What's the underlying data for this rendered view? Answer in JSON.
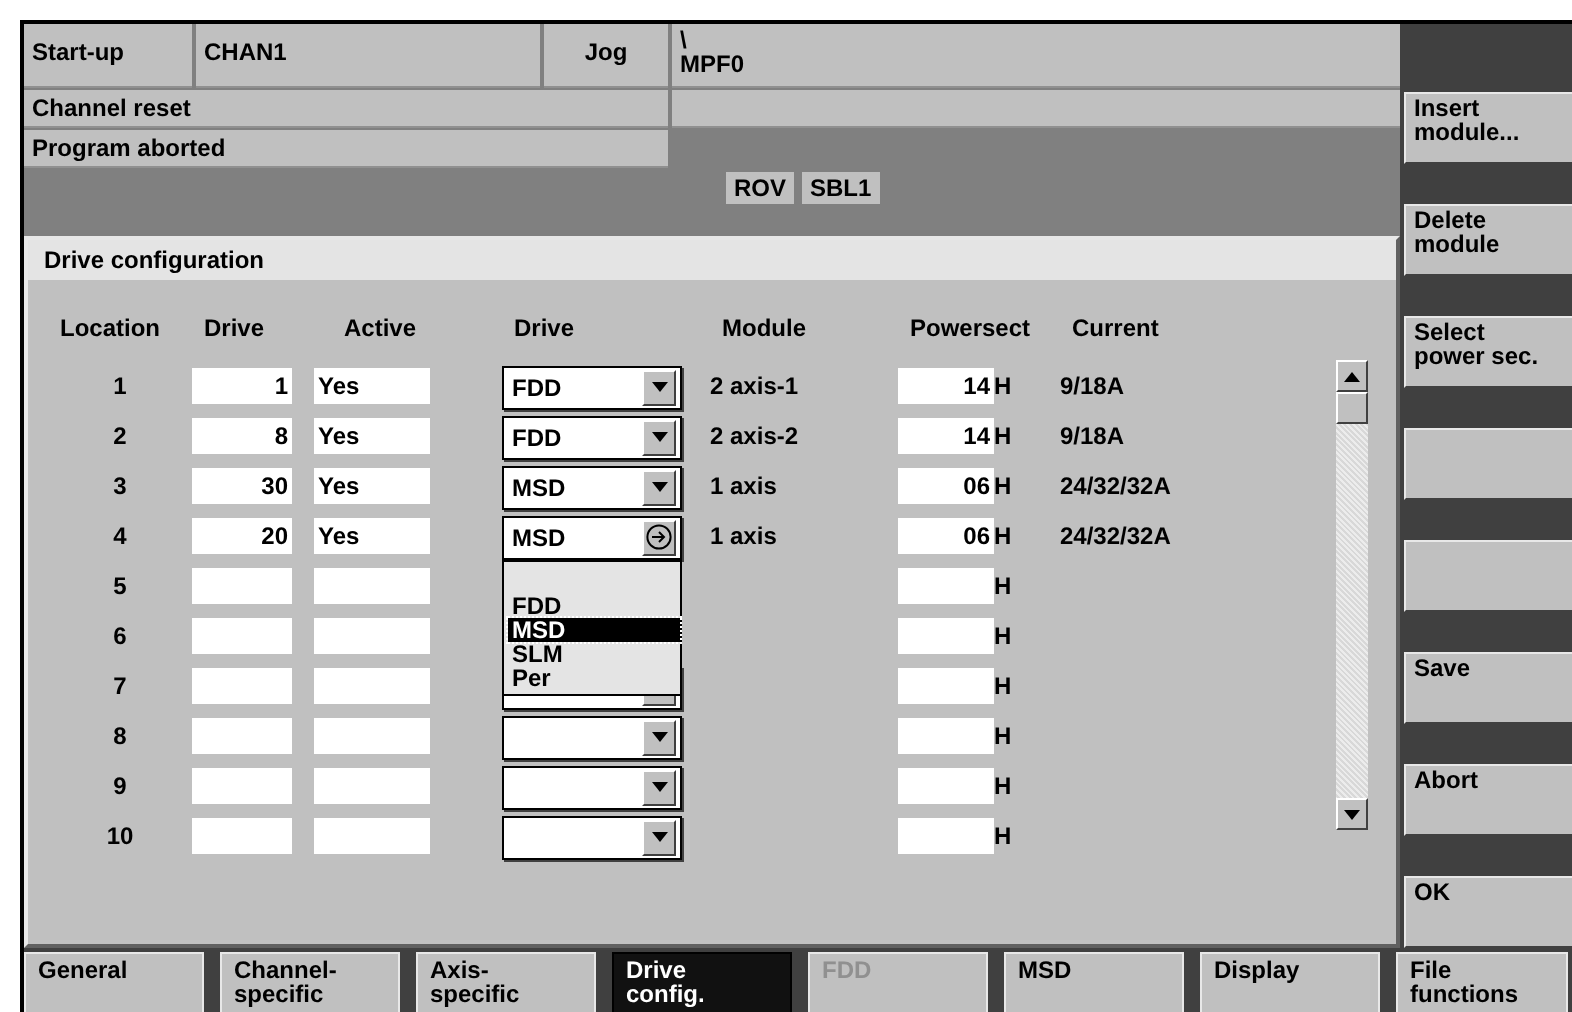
{
  "header": {
    "mode": "Start-up",
    "channel": "CHAN1",
    "op_mode": "Jog",
    "path": "\\",
    "program": "MPF0",
    "status_1": "Channel reset",
    "status_2": "Program aborted",
    "indicators": [
      "ROV",
      "SBL1"
    ]
  },
  "panel": {
    "title": "Drive configuration",
    "columns": [
      "Location",
      "Drive",
      "Active",
      "Drive",
      "Module",
      "Powersect",
      "Current"
    ],
    "rows": [
      {
        "location": "1",
        "drive": "1",
        "active": "Yes",
        "combo": true,
        "open": false,
        "drive_type": "FDD",
        "module": "2 axis-1",
        "powersect": "14",
        "unit": "H",
        "current": "9/18A"
      },
      {
        "location": "2",
        "drive": "8",
        "active": "Yes",
        "combo": true,
        "open": false,
        "drive_type": "FDD",
        "module": "2 axis-2",
        "powersect": "14",
        "unit": "H",
        "current": "9/18A"
      },
      {
        "location": "3",
        "drive": "30",
        "active": "Yes",
        "combo": true,
        "open": false,
        "drive_type": "MSD",
        "module": "1 axis",
        "powersect": "06",
        "unit": "H",
        "current": "24/32/32A"
      },
      {
        "location": "4",
        "drive": "20",
        "active": "Yes",
        "combo": true,
        "open": true,
        "drive_type": "MSD",
        "module": "1 axis",
        "powersect": "06",
        "unit": "H",
        "current": "24/32/32A"
      },
      {
        "location": "5",
        "combo": false,
        "unit": "H"
      },
      {
        "location": "6",
        "combo": false,
        "unit": "H"
      },
      {
        "location": "7",
        "combo": true,
        "open": false,
        "unit": "H"
      },
      {
        "location": "8",
        "combo": true,
        "open": false,
        "unit": "H"
      },
      {
        "location": "9",
        "combo": true,
        "open": false,
        "unit": "H"
      },
      {
        "location": "10",
        "combo": true,
        "open": false,
        "unit": "H"
      }
    ],
    "dropdown": [
      {
        "label": "FDD",
        "selected": false
      },
      {
        "label": "MSD",
        "selected": true
      },
      {
        "label": "SLM",
        "selected": false
      },
      {
        "label": "Per",
        "selected": false
      }
    ]
  },
  "softkeys_right": [
    {
      "kind": "labeled",
      "label": "Insert\nmodule..."
    },
    {
      "kind": "labeled",
      "label": "Delete\nmodule"
    },
    {
      "kind": "labeled",
      "label": "Select\npower sec."
    },
    {
      "kind": "blank"
    },
    {
      "kind": "blank"
    },
    {
      "kind": "labeled",
      "label": "Save"
    },
    {
      "kind": "labeled",
      "label": "Abort"
    },
    {
      "kind": "labeled",
      "label": "OK"
    }
  ],
  "softkeys_bottom": [
    {
      "label": "General",
      "selected": false,
      "disabled": false
    },
    {
      "label": "Channel-\nspecific",
      "selected": false,
      "disabled": false
    },
    {
      "label": "Axis-\nspecific",
      "selected": false,
      "disabled": false
    },
    {
      "label": "Drive\nconfig.",
      "selected": true,
      "disabled": false
    },
    {
      "label": "FDD",
      "selected": false,
      "disabled": true
    },
    {
      "label": "MSD",
      "selected": false,
      "disabled": false
    },
    {
      "label": "Display",
      "selected": false,
      "disabled": false
    },
    {
      "label": "File\nfunctions",
      "selected": false,
      "disabled": false
    }
  ]
}
